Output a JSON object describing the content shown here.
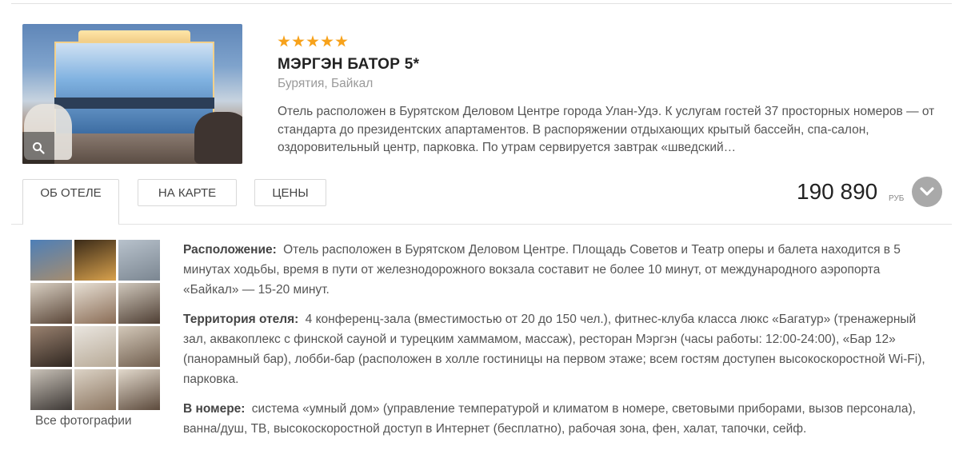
{
  "hotel": {
    "stars": 5,
    "name": "МЭРГЭН БАТОР 5*",
    "region": "Бурятия, Байкал",
    "description": "Отель расположен в Бурятском Деловом Центре города Улан-Удэ. К услугам гостей 37 просторных номеров — от стандарта до президентских апартаментов. В распоряжении отдыхающих крытый бассейн, спа-салон, оздоровительный центр, парковка. По утрам сервируется завтрак «шведский…"
  },
  "tabs": [
    {
      "label": "ОБ ОТЕЛЕ",
      "active": true
    },
    {
      "label": "НА КАРТЕ",
      "active": false
    },
    {
      "label": "ЦЕНЫ",
      "active": false
    }
  ],
  "price": {
    "value": "190 890",
    "currency": "РУБ"
  },
  "icons": {
    "zoom": "search-icon",
    "expand": "chevron-down-icon",
    "rating": "star-icon"
  },
  "colors": {
    "star": "#f7a21b",
    "expand_button": "#a9a9a9"
  },
  "gallery": {
    "all_photos_label": "Все фотографии",
    "thumbs": [
      {
        "c1": "#4d7fb8",
        "c2": "#a58d70"
      },
      {
        "c1": "#3a2a18",
        "c2": "#d9a24d"
      },
      {
        "c1": "#b8c2cc",
        "c2": "#7b8691"
      },
      {
        "c1": "#d8cfc2",
        "c2": "#5a4638"
      },
      {
        "c1": "#e6dfd4",
        "c2": "#8a6c55"
      },
      {
        "c1": "#cfc7bb",
        "c2": "#4e3e33"
      },
      {
        "c1": "#9a8270",
        "c2": "#2f2620"
      },
      {
        "c1": "#eae6e0",
        "c2": "#b7a996"
      },
      {
        "c1": "#d3c8b9",
        "c2": "#6f5d4d"
      },
      {
        "c1": "#c9c2b8",
        "c2": "#3d3835"
      },
      {
        "c1": "#dcd3c6",
        "c2": "#8b7560"
      },
      {
        "c1": "#e2d9cc",
        "c2": "#5c4a3c"
      }
    ]
  },
  "info": {
    "location_label": "Расположение:",
    "location_text": "Отель расположен в Бурятском Деловом Центре. Площадь Советов и Театр оперы и балета находится в 5 минутах ходьбы, время в пути от железнодорожного вокзала составит не более 10 минут, от международного аэропорта «Байкал» — 15-20 минут.",
    "territory_label": "Территория отеля:",
    "territory_text": "4 конференц-зала (вместимостью от 20 до 150 чел.), фитнес-клуба класса люкс «Багатур» (тренажерный зал, аквакоплекс с финской сауной и турецким хаммамом, массаж), ресторан Мэргэн (часы работы: 12:00-24:00), «Бар 12» (панорамный бар), лобби-бар (расположен в холле гостиницы на первом этаже; всем гостям доступен высокоскоростной Wi-Fi), парковка.",
    "room_label": "В номере:",
    "room_text": "система «умный дом» (управление температурой и климатом в номере, световыми приборами, вызов персонала), ванна/душ, ТВ, высокоскоростной доступ в Интернет (бесплатно), рабочая зона, фен, халат, тапочки, сейф."
  }
}
